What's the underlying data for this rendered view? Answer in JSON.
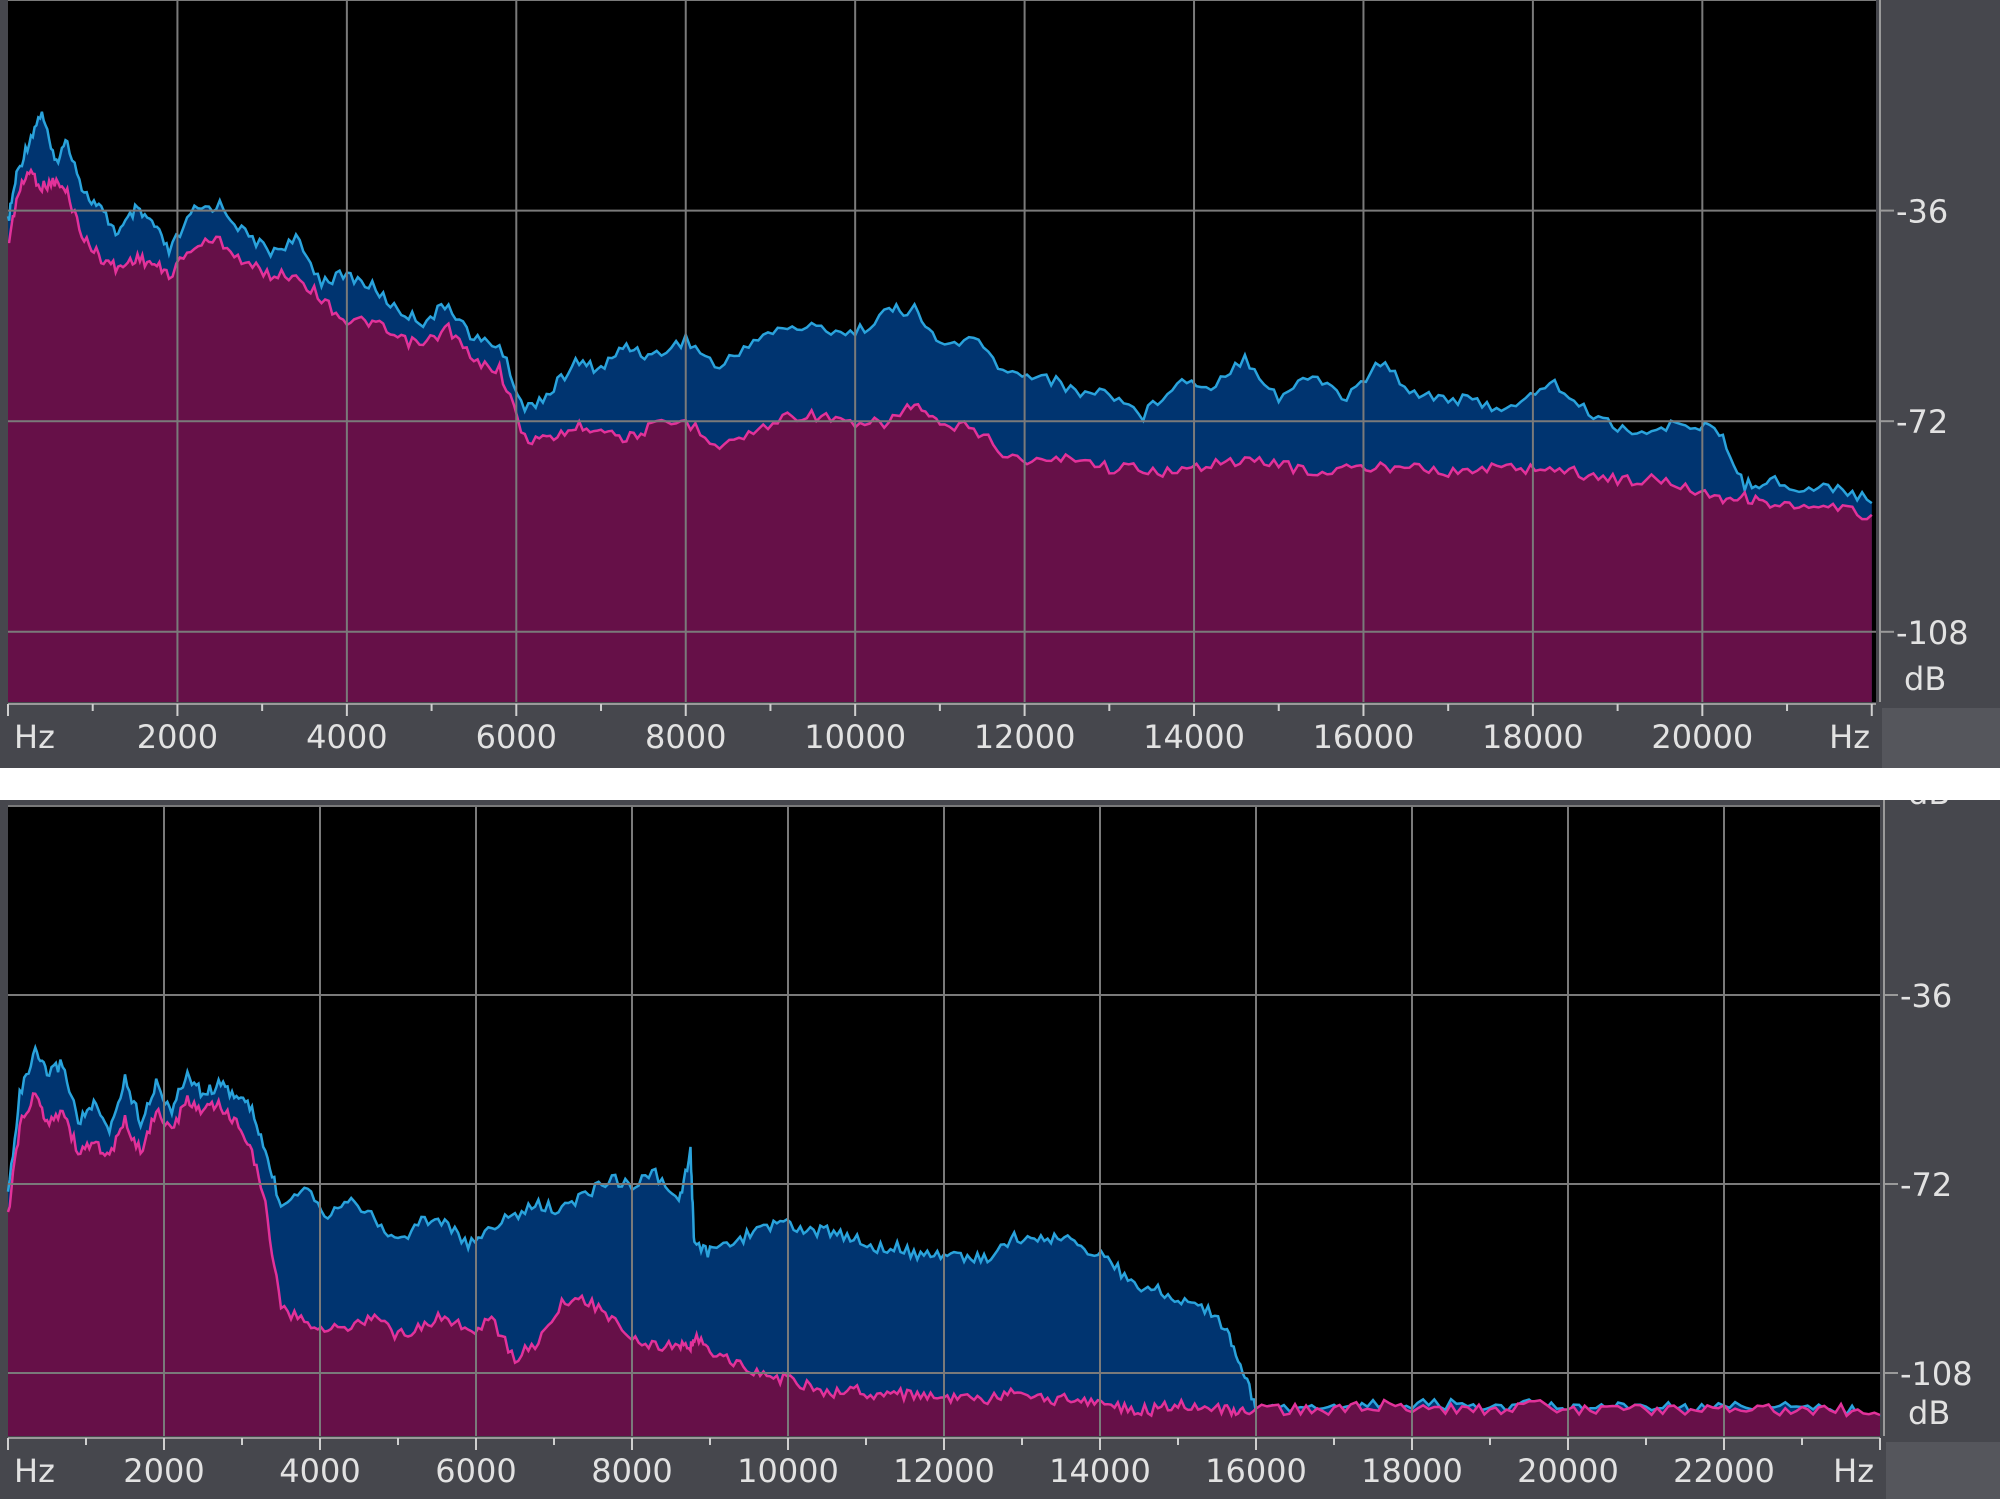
{
  "chart_data": [
    {
      "type": "area",
      "title": "",
      "x_unit_label_left": "Hz",
      "x_unit_label_right": "Hz",
      "y_unit_label_top": "dB",
      "y_unit_label_bottom": "dB",
      "xlim": [
        0,
        22050
      ],
      "ylim": [
        -120,
        0
      ],
      "grid": true,
      "x_ticks": [
        2000,
        4000,
        6000,
        8000,
        10000,
        12000,
        14000,
        16000,
        18000,
        20000
      ],
      "y_ticks": [
        -36,
        -72,
        -108
      ],
      "colors": {
        "background": "#000000",
        "grid": "#7a7a7a",
        "blue_fill": "#003470",
        "blue_line": "#2aa3dc",
        "magenta_fill": "#661048",
        "magenta_line": "#e2329a"
      },
      "series": [
        {
          "role": "blue",
          "x": [
            0,
            100,
            250,
            400,
            550,
            700,
            900,
            1100,
            1300,
            1500,
            1700,
            1900,
            2200,
            2500,
            2800,
            3100,
            3400,
            3700,
            4000,
            4300,
            4600,
            4900,
            5200,
            5500,
            5800,
            6100,
            6400,
            6700,
            7000,
            7300,
            7600,
            8000,
            8400,
            8800,
            9200,
            9600,
            10000,
            10400,
            10700,
            11000,
            11400,
            11800,
            12200,
            12600,
            13000,
            13400,
            13800,
            14200,
            14600,
            15000,
            15400,
            15800,
            16200,
            16600,
            17000,
            17400,
            17800,
            18200,
            18600,
            19000,
            19400,
            19800,
            20200,
            20500,
            20800,
            21200,
            21600,
            22000
          ],
          "y": [
            -38,
            -30,
            -24,
            -19,
            -28,
            -24,
            -33,
            -36,
            -40,
            -36,
            -38,
            -43,
            -36,
            -35,
            -40,
            -43,
            -41,
            -48,
            -47,
            -49,
            -53,
            -55,
            -52,
            -58,
            -59,
            -70,
            -67,
            -62,
            -63,
            -59,
            -61,
            -58,
            -63,
            -58,
            -56,
            -56,
            -57,
            -53,
            -53,
            -59,
            -58,
            -64,
            -64,
            -67,
            -67,
            -71,
            -65,
            -66,
            -61,
            -68,
            -64,
            -68,
            -62,
            -67,
            -68,
            -69,
            -70,
            -65,
            -70,
            -73,
            -74,
            -72,
            -74,
            -83,
            -82,
            -84,
            -83,
            -86
          ]
        },
        {
          "role": "magenta",
          "x": [
            0,
            100,
            250,
            400,
            550,
            700,
            900,
            1100,
            1300,
            1500,
            1700,
            1900,
            2200,
            2500,
            2800,
            3100,
            3400,
            3700,
            4000,
            4300,
            4600,
            4900,
            5200,
            5500,
            5800,
            6100,
            6400,
            6700,
            7000,
            7300,
            7600,
            8000,
            8400,
            8800,
            9200,
            9600,
            10000,
            10400,
            10700,
            11000,
            11400,
            11800,
            12200,
            12600,
            13000,
            13400,
            13800,
            14200,
            14600,
            15000,
            15400,
            15800,
            16200,
            16600,
            17000,
            17400,
            17800,
            18200,
            18600,
            19000,
            19400,
            19800,
            20200,
            20500,
            20800,
            21200,
            21600,
            22000
          ],
          "y": [
            -42,
            -34,
            -29,
            -32,
            -31,
            -33,
            -41,
            -44,
            -46,
            -44,
            -45,
            -47,
            -42,
            -41,
            -45,
            -47,
            -47,
            -51,
            -55,
            -55,
            -58,
            -59,
            -56,
            -62,
            -63,
            -75,
            -75,
            -73,
            -73,
            -75,
            -73,
            -72,
            -76,
            -74,
            -71,
            -71,
            -73,
            -72,
            -69,
            -73,
            -73,
            -78,
            -79,
            -78,
            -80,
            -80,
            -81,
            -79,
            -79,
            -79,
            -81,
            -80,
            -80,
            -79,
            -81,
            -80,
            -80,
            -80,
            -81,
            -82,
            -82,
            -83,
            -85,
            -85,
            -86,
            -87,
            -87,
            -88
          ]
        }
      ]
    },
    {
      "type": "area",
      "title": "",
      "x_unit_label_left": "Hz",
      "x_unit_label_right": "Hz",
      "y_unit_label_top": "dB",
      "y_unit_label_bottom": "dB",
      "xlim": [
        0,
        24000
      ],
      "ylim": [
        -120,
        0
      ],
      "grid": true,
      "x_ticks": [
        2000,
        4000,
        6000,
        8000,
        10000,
        12000,
        14000,
        16000,
        18000,
        20000,
        22000
      ],
      "y_ticks": [
        -36,
        -72,
        -108
      ],
      "colors": {
        "background": "#000000",
        "grid": "#7a7a7a",
        "blue_fill": "#003470",
        "blue_line": "#2aa3dc",
        "magenta_fill": "#661048",
        "magenta_line": "#e2329a"
      },
      "series": [
        {
          "role": "blue",
          "x": [
            0,
            150,
            350,
            500,
            700,
            900,
            1100,
            1300,
            1500,
            1700,
            1900,
            2100,
            2300,
            2500,
            2700,
            2900,
            3100,
            3300,
            3500,
            3800,
            4100,
            4400,
            4700,
            5000,
            5300,
            5600,
            5900,
            6200,
            6500,
            6800,
            7100,
            7400,
            7700,
            8000,
            8300,
            8600,
            8750,
            8800,
            9000,
            9300,
            9600,
            9900,
            10200,
            10500,
            10800,
            11100,
            11400,
            11700,
            12000,
            12300,
            12600,
            12900,
            13200,
            13500,
            13800,
            14100,
            14400,
            14700,
            15000,
            15300,
            15600,
            15800,
            16000,
            16500,
            17000,
            17500,
            18000,
            18500,
            19000,
            19500,
            20000,
            20500,
            21000,
            21500,
            22000,
            22500,
            23000,
            23500,
            24000
          ],
          "y": [
            -74,
            -55,
            -47,
            -51,
            -49,
            -60,
            -57,
            -62,
            -52,
            -60,
            -53,
            -58,
            -51,
            -55,
            -53,
            -55,
            -57,
            -66,
            -76,
            -72,
            -78,
            -74,
            -79,
            -83,
            -79,
            -79,
            -84,
            -80,
            -78,
            -76,
            -77,
            -74,
            -71,
            -72,
            -70,
            -76,
            -66,
            -84,
            -85,
            -83,
            -81,
            -79,
            -81,
            -81,
            -82,
            -84,
            -84,
            -86,
            -85,
            -86,
            -86,
            -82,
            -83,
            -82,
            -84,
            -86,
            -91,
            -92,
            -94,
            -95,
            -99,
            -106,
            -115,
            -114,
            -115,
            -114,
            -114,
            -114,
            -115,
            -114,
            -115,
            -115,
            -114,
            -115,
            -114,
            -115,
            -114,
            -115,
            -116
          ]
        },
        {
          "role": "magenta",
          "x": [
            0,
            150,
            350,
            500,
            700,
            900,
            1100,
            1300,
            1500,
            1700,
            1900,
            2100,
            2300,
            2500,
            2700,
            2900,
            3100,
            3300,
            3500,
            3800,
            4100,
            4400,
            4700,
            5000,
            5300,
            5600,
            5900,
            6200,
            6500,
            6800,
            7100,
            7400,
            7700,
            8000,
            8300,
            8600,
            8750,
            8800,
            9000,
            9300,
            9600,
            9900,
            10200,
            10500,
            10800,
            11100,
            11400,
            11700,
            12000,
            12300,
            12600,
            12900,
            13200,
            13500,
            13800,
            14100,
            14400,
            14700,
            15000,
            15300,
            15600,
            15800,
            16000,
            16500,
            17000,
            17500,
            18000,
            18500,
            19000,
            19500,
            20000,
            20500,
            21000,
            21500,
            22000,
            22500,
            23000,
            23500,
            24000
          ],
          "y": [
            -78,
            -61,
            -55,
            -60,
            -58,
            -66,
            -64,
            -67,
            -60,
            -66,
            -58,
            -62,
            -56,
            -58,
            -57,
            -60,
            -64,
            -76,
            -96,
            -98,
            -100,
            -99,
            -97,
            -101,
            -99,
            -97,
            -100,
            -98,
            -105,
            -102,
            -95,
            -94,
            -97,
            -101,
            -103,
            -103,
            -103,
            -101,
            -104,
            -106,
            -108,
            -109,
            -110,
            -112,
            -111,
            -112,
            -112,
            -112,
            -113,
            -113,
            -113,
            -112,
            -113,
            -113,
            -113,
            -114,
            -115,
            -115,
            -114,
            -114,
            -115,
            -115,
            -115,
            -115,
            -115,
            -114,
            -115,
            -115,
            -115,
            -114,
            -115,
            -115,
            -115,
            -115,
            -115,
            -115,
            -115,
            -115,
            -116
          ]
        }
      ]
    }
  ],
  "axis_labels": {
    "hz": "Hz",
    "db": "dB"
  }
}
